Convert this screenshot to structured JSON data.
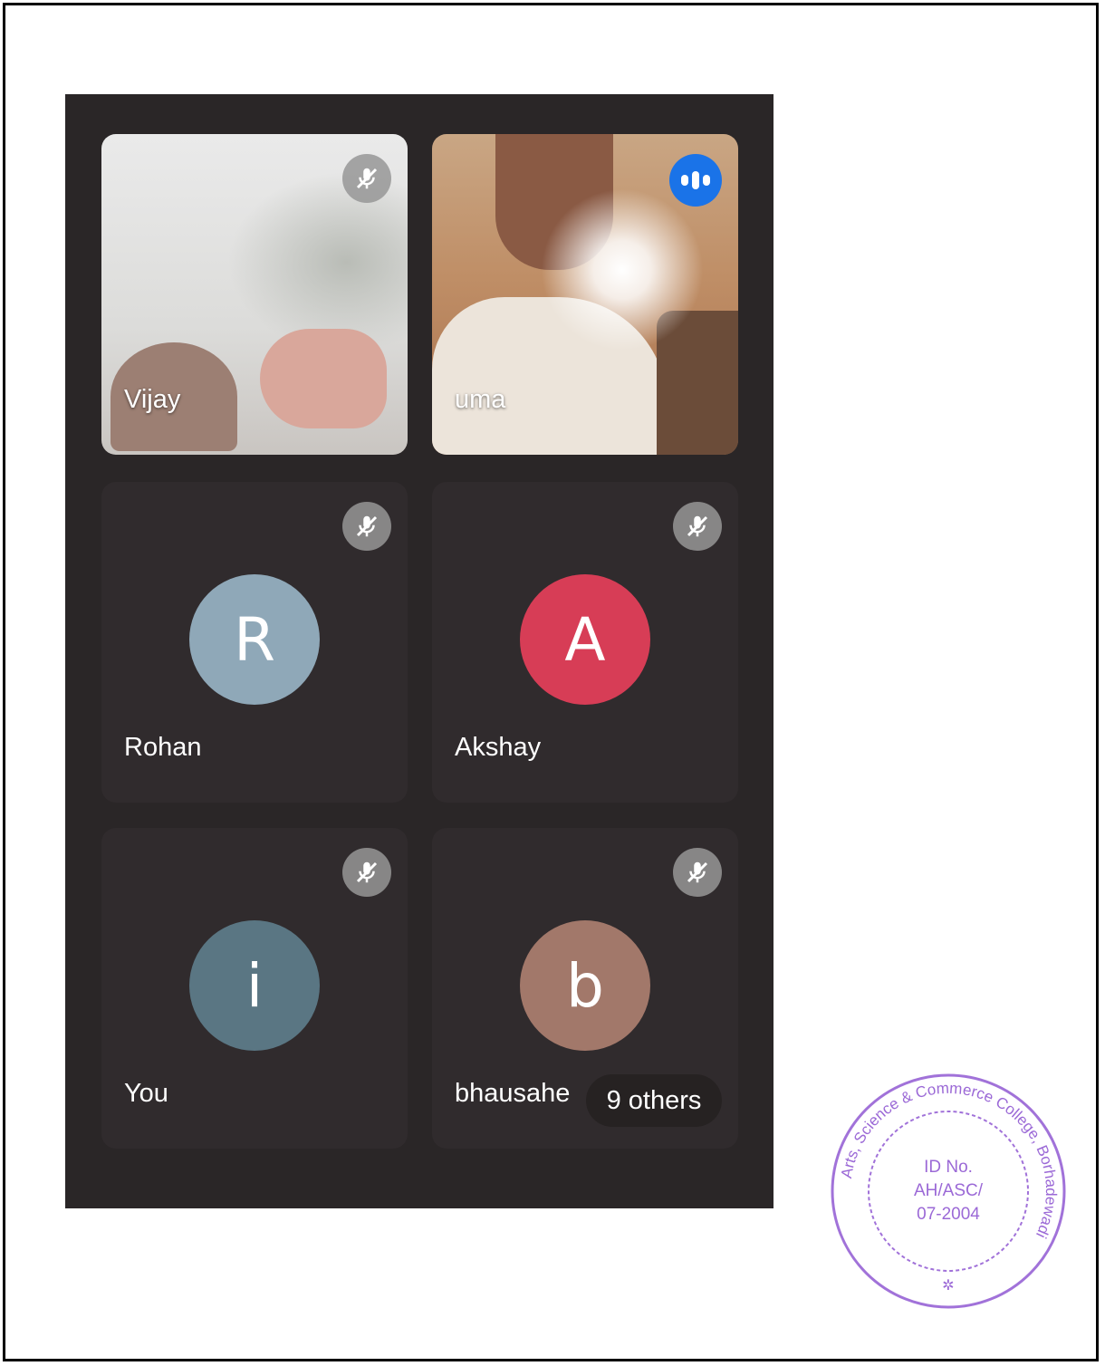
{
  "participants": [
    {
      "name": "Vijay",
      "type": "video",
      "status": "muted"
    },
    {
      "name": "uma",
      "type": "video",
      "status": "speaking"
    },
    {
      "name": "Rohan",
      "type": "avatar",
      "initial": "R",
      "avatar_color": "#8fa8b8",
      "status": "muted"
    },
    {
      "name": "Akshay",
      "type": "avatar",
      "initial": "A",
      "avatar_color": "#d73d56",
      "status": "muted"
    },
    {
      "name": "You",
      "type": "avatar",
      "initial": "i",
      "avatar_color": "#5a7683",
      "status": "muted"
    },
    {
      "name": "bhausahe",
      "type": "avatar",
      "initial": "b",
      "avatar_color": "#a2786a",
      "status": "muted"
    }
  ],
  "others_label": "9 others",
  "icons": {
    "mute": "mic-off-icon",
    "speaking": "audio-level-icon"
  },
  "stamp": {
    "ring_text": "Arts, Science & Commerce College, Borhadewadi",
    "id_line": "ID No.",
    "code": "AH/ASC/",
    "number": "07-2004"
  },
  "colors": {
    "background": "#2a2627",
    "tile": "#302b2d",
    "speaking_accent": "#1a73e8",
    "stamp": "#8a4fd0"
  }
}
